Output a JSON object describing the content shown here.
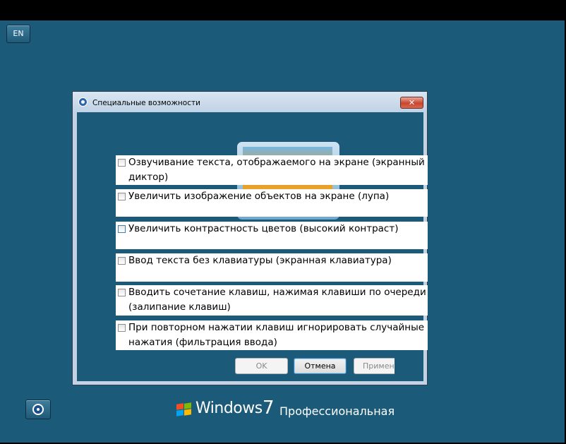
{
  "language_button": {
    "label": "EN"
  },
  "dialog": {
    "title": "Специальные возможности",
    "close_label": "✕",
    "options": [
      {
        "label": "Озвучивание текста, отображаемого на экране (экранный диктор)",
        "checked": false
      },
      {
        "label": "Увеличить изображение объектов на экране (лупа)",
        "checked": false
      },
      {
        "label": "Увеличить контрастность цветов (высокий контраст)",
        "checked": false
      },
      {
        "label": "Ввод текста без клавиатуры (экранная клавиатура)",
        "checked": false
      },
      {
        "label": "Вводить сочетание клавиш, нажимая клавиши по очереди (залипание клавиш)",
        "checked": false
      },
      {
        "label": "При повторном нажатии клавиш игнорировать случайные нажатия (фильтрация ввода)",
        "checked": false
      }
    ],
    "buttons": {
      "ok": "OK",
      "cancel": "Отмена",
      "apply": "Примени"
    }
  },
  "branding": {
    "name": "Windows",
    "version": "7",
    "edition": "Профессиональная"
  },
  "icons": {
    "title": "ease-of-access-icon",
    "ease_button": "ease-of-access-icon",
    "flag": "windows-flag-icon"
  },
  "colors": {
    "desktop": "#1b5a78",
    "close_button": "#c9452e"
  }
}
